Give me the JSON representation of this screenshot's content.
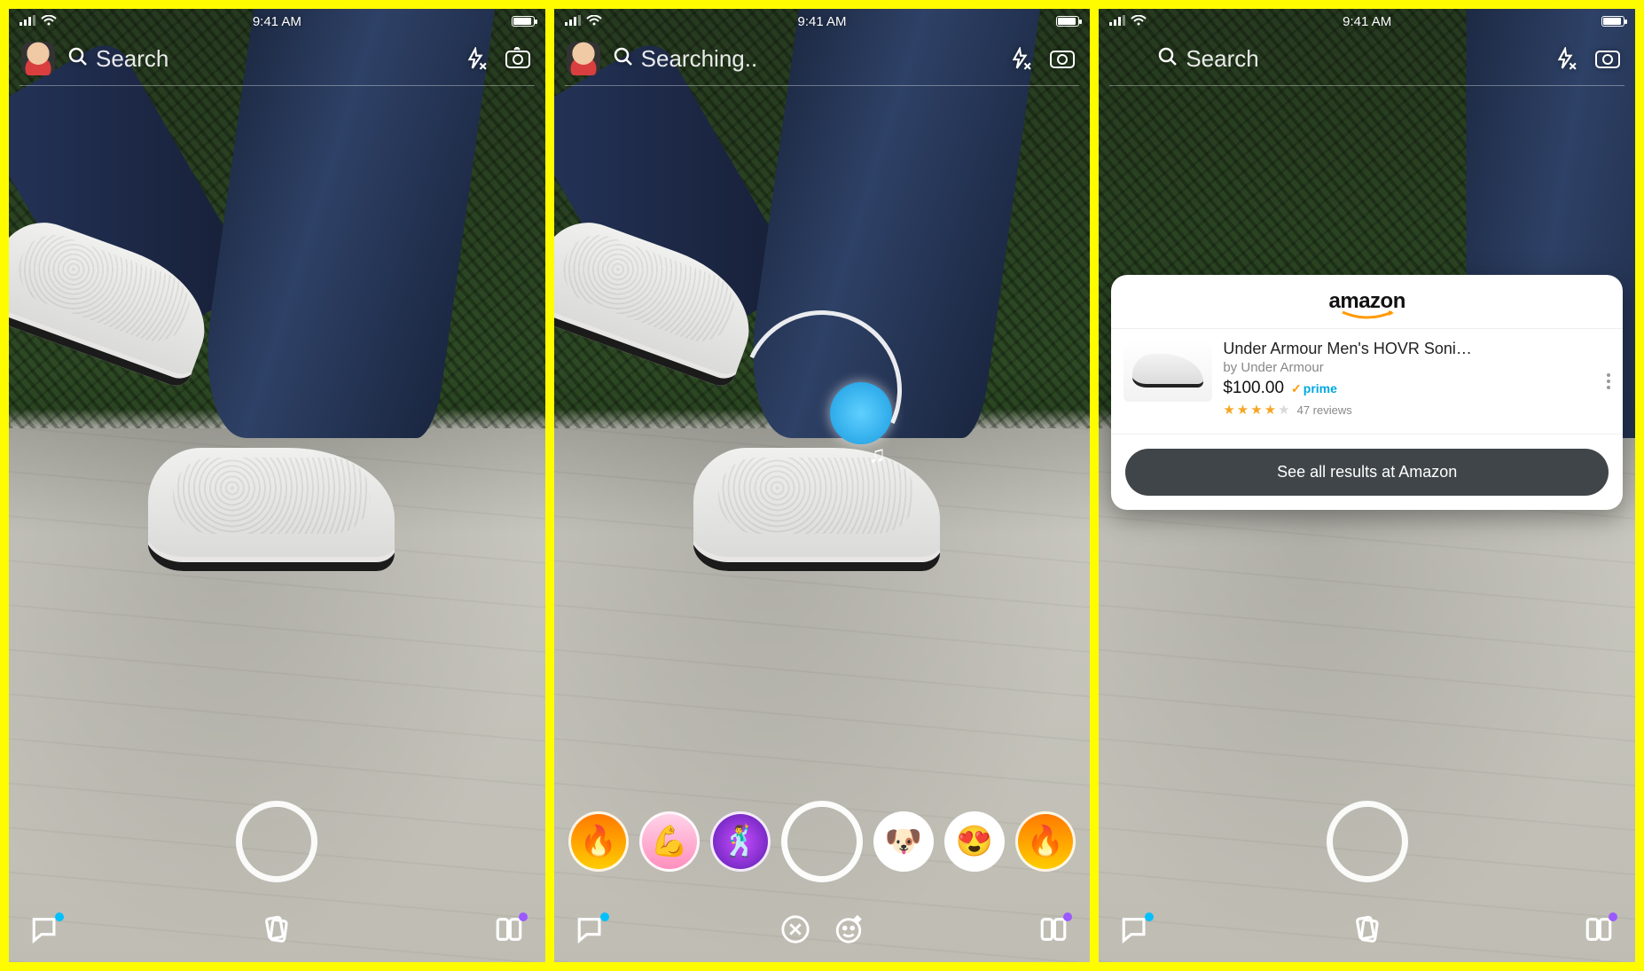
{
  "status": {
    "time": "9:41 AM"
  },
  "topbar": {
    "search_label": "Search",
    "searching_label": "Searching.."
  },
  "lenses": {
    "items": [
      {
        "name": "lens-fire-partial",
        "emoji": "🔥"
      },
      {
        "name": "lens-muscle",
        "emoji": "💪"
      },
      {
        "name": "lens-dancer",
        "emoji": "🕺"
      },
      {
        "name": "lens-capture",
        "emoji": ""
      },
      {
        "name": "lens-puppy",
        "emoji": "🐶"
      },
      {
        "name": "lens-hearteyes",
        "emoji": "😍"
      },
      {
        "name": "lens-fire",
        "emoji": "🔥"
      }
    ]
  },
  "indicators": {
    "chat_dot_color": "#00c0ff",
    "stories_dot_color": "#9b59ff"
  },
  "product_card": {
    "store_name": "amazon",
    "title": "Under Armour Men's HOVR Soni…",
    "brand_prefix": "by ",
    "brand": "Under Armour",
    "price": "$100.00",
    "prime_label": "prime",
    "rating_stars": 4,
    "rating_max": 5,
    "reviews_text": "47 reviews",
    "cta_label": "See all results at Amazon"
  }
}
